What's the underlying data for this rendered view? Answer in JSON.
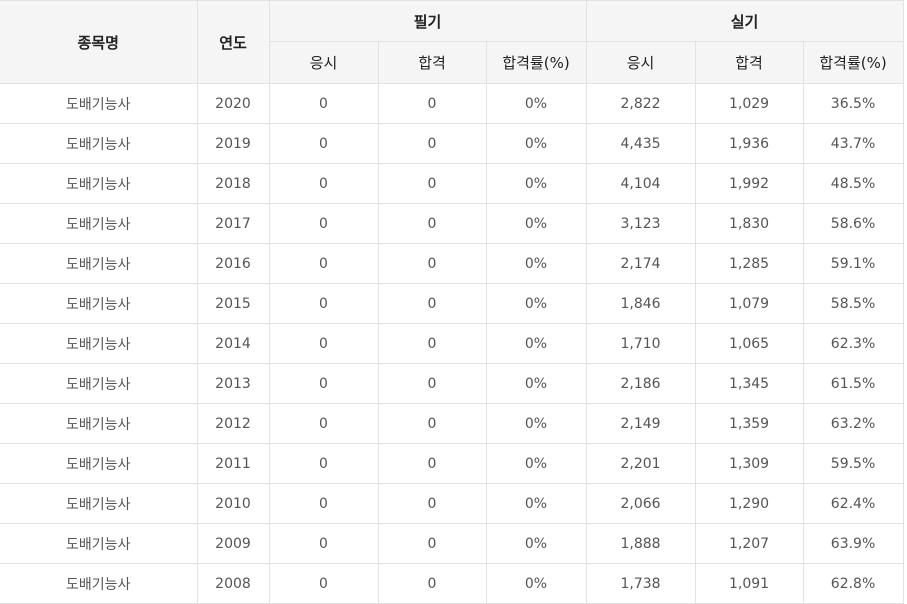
{
  "header": {
    "item_name": "종목명",
    "year": "연도",
    "written": "필기",
    "practical": "실기",
    "applicants": "응시",
    "passed": "합격",
    "pass_rate": "합격률(%)"
  },
  "rows": [
    {
      "name": "도배기능사",
      "year": "2020",
      "w_apply": "0",
      "w_pass": "0",
      "w_rate": "0%",
      "p_apply": "2,822",
      "p_pass": "1,029",
      "p_rate": "36.5%"
    },
    {
      "name": "도배기능사",
      "year": "2019",
      "w_apply": "0",
      "w_pass": "0",
      "w_rate": "0%",
      "p_apply": "4,435",
      "p_pass": "1,936",
      "p_rate": "43.7%"
    },
    {
      "name": "도배기능사",
      "year": "2018",
      "w_apply": "0",
      "w_pass": "0",
      "w_rate": "0%",
      "p_apply": "4,104",
      "p_pass": "1,992",
      "p_rate": "48.5%"
    },
    {
      "name": "도배기능사",
      "year": "2017",
      "w_apply": "0",
      "w_pass": "0",
      "w_rate": "0%",
      "p_apply": "3,123",
      "p_pass": "1,830",
      "p_rate": "58.6%"
    },
    {
      "name": "도배기능사",
      "year": "2016",
      "w_apply": "0",
      "w_pass": "0",
      "w_rate": "0%",
      "p_apply": "2,174",
      "p_pass": "1,285",
      "p_rate": "59.1%"
    },
    {
      "name": "도배기능사",
      "year": "2015",
      "w_apply": "0",
      "w_pass": "0",
      "w_rate": "0%",
      "p_apply": "1,846",
      "p_pass": "1,079",
      "p_rate": "58.5%"
    },
    {
      "name": "도배기능사",
      "year": "2014",
      "w_apply": "0",
      "w_pass": "0",
      "w_rate": "0%",
      "p_apply": "1,710",
      "p_pass": "1,065",
      "p_rate": "62.3%"
    },
    {
      "name": "도배기능사",
      "year": "2013",
      "w_apply": "0",
      "w_pass": "0",
      "w_rate": "0%",
      "p_apply": "2,186",
      "p_pass": "1,345",
      "p_rate": "61.5%"
    },
    {
      "name": "도배기능사",
      "year": "2012",
      "w_apply": "0",
      "w_pass": "0",
      "w_rate": "0%",
      "p_apply": "2,149",
      "p_pass": "1,359",
      "p_rate": "63.2%"
    },
    {
      "name": "도배기능사",
      "year": "2011",
      "w_apply": "0",
      "w_pass": "0",
      "w_rate": "0%",
      "p_apply": "2,201",
      "p_pass": "1,309",
      "p_rate": "59.5%"
    },
    {
      "name": "도배기능사",
      "year": "2010",
      "w_apply": "0",
      "w_pass": "0",
      "w_rate": "0%",
      "p_apply": "2,066",
      "p_pass": "1,290",
      "p_rate": "62.4%"
    },
    {
      "name": "도배기능사",
      "year": "2009",
      "w_apply": "0",
      "w_pass": "0",
      "w_rate": "0%",
      "p_apply": "1,888",
      "p_pass": "1,207",
      "p_rate": "63.9%"
    },
    {
      "name": "도배기능사",
      "year": "2008",
      "w_apply": "0",
      "w_pass": "0",
      "w_rate": "0%",
      "p_apply": "1,738",
      "p_pass": "1,091",
      "p_rate": "62.8%"
    }
  ]
}
